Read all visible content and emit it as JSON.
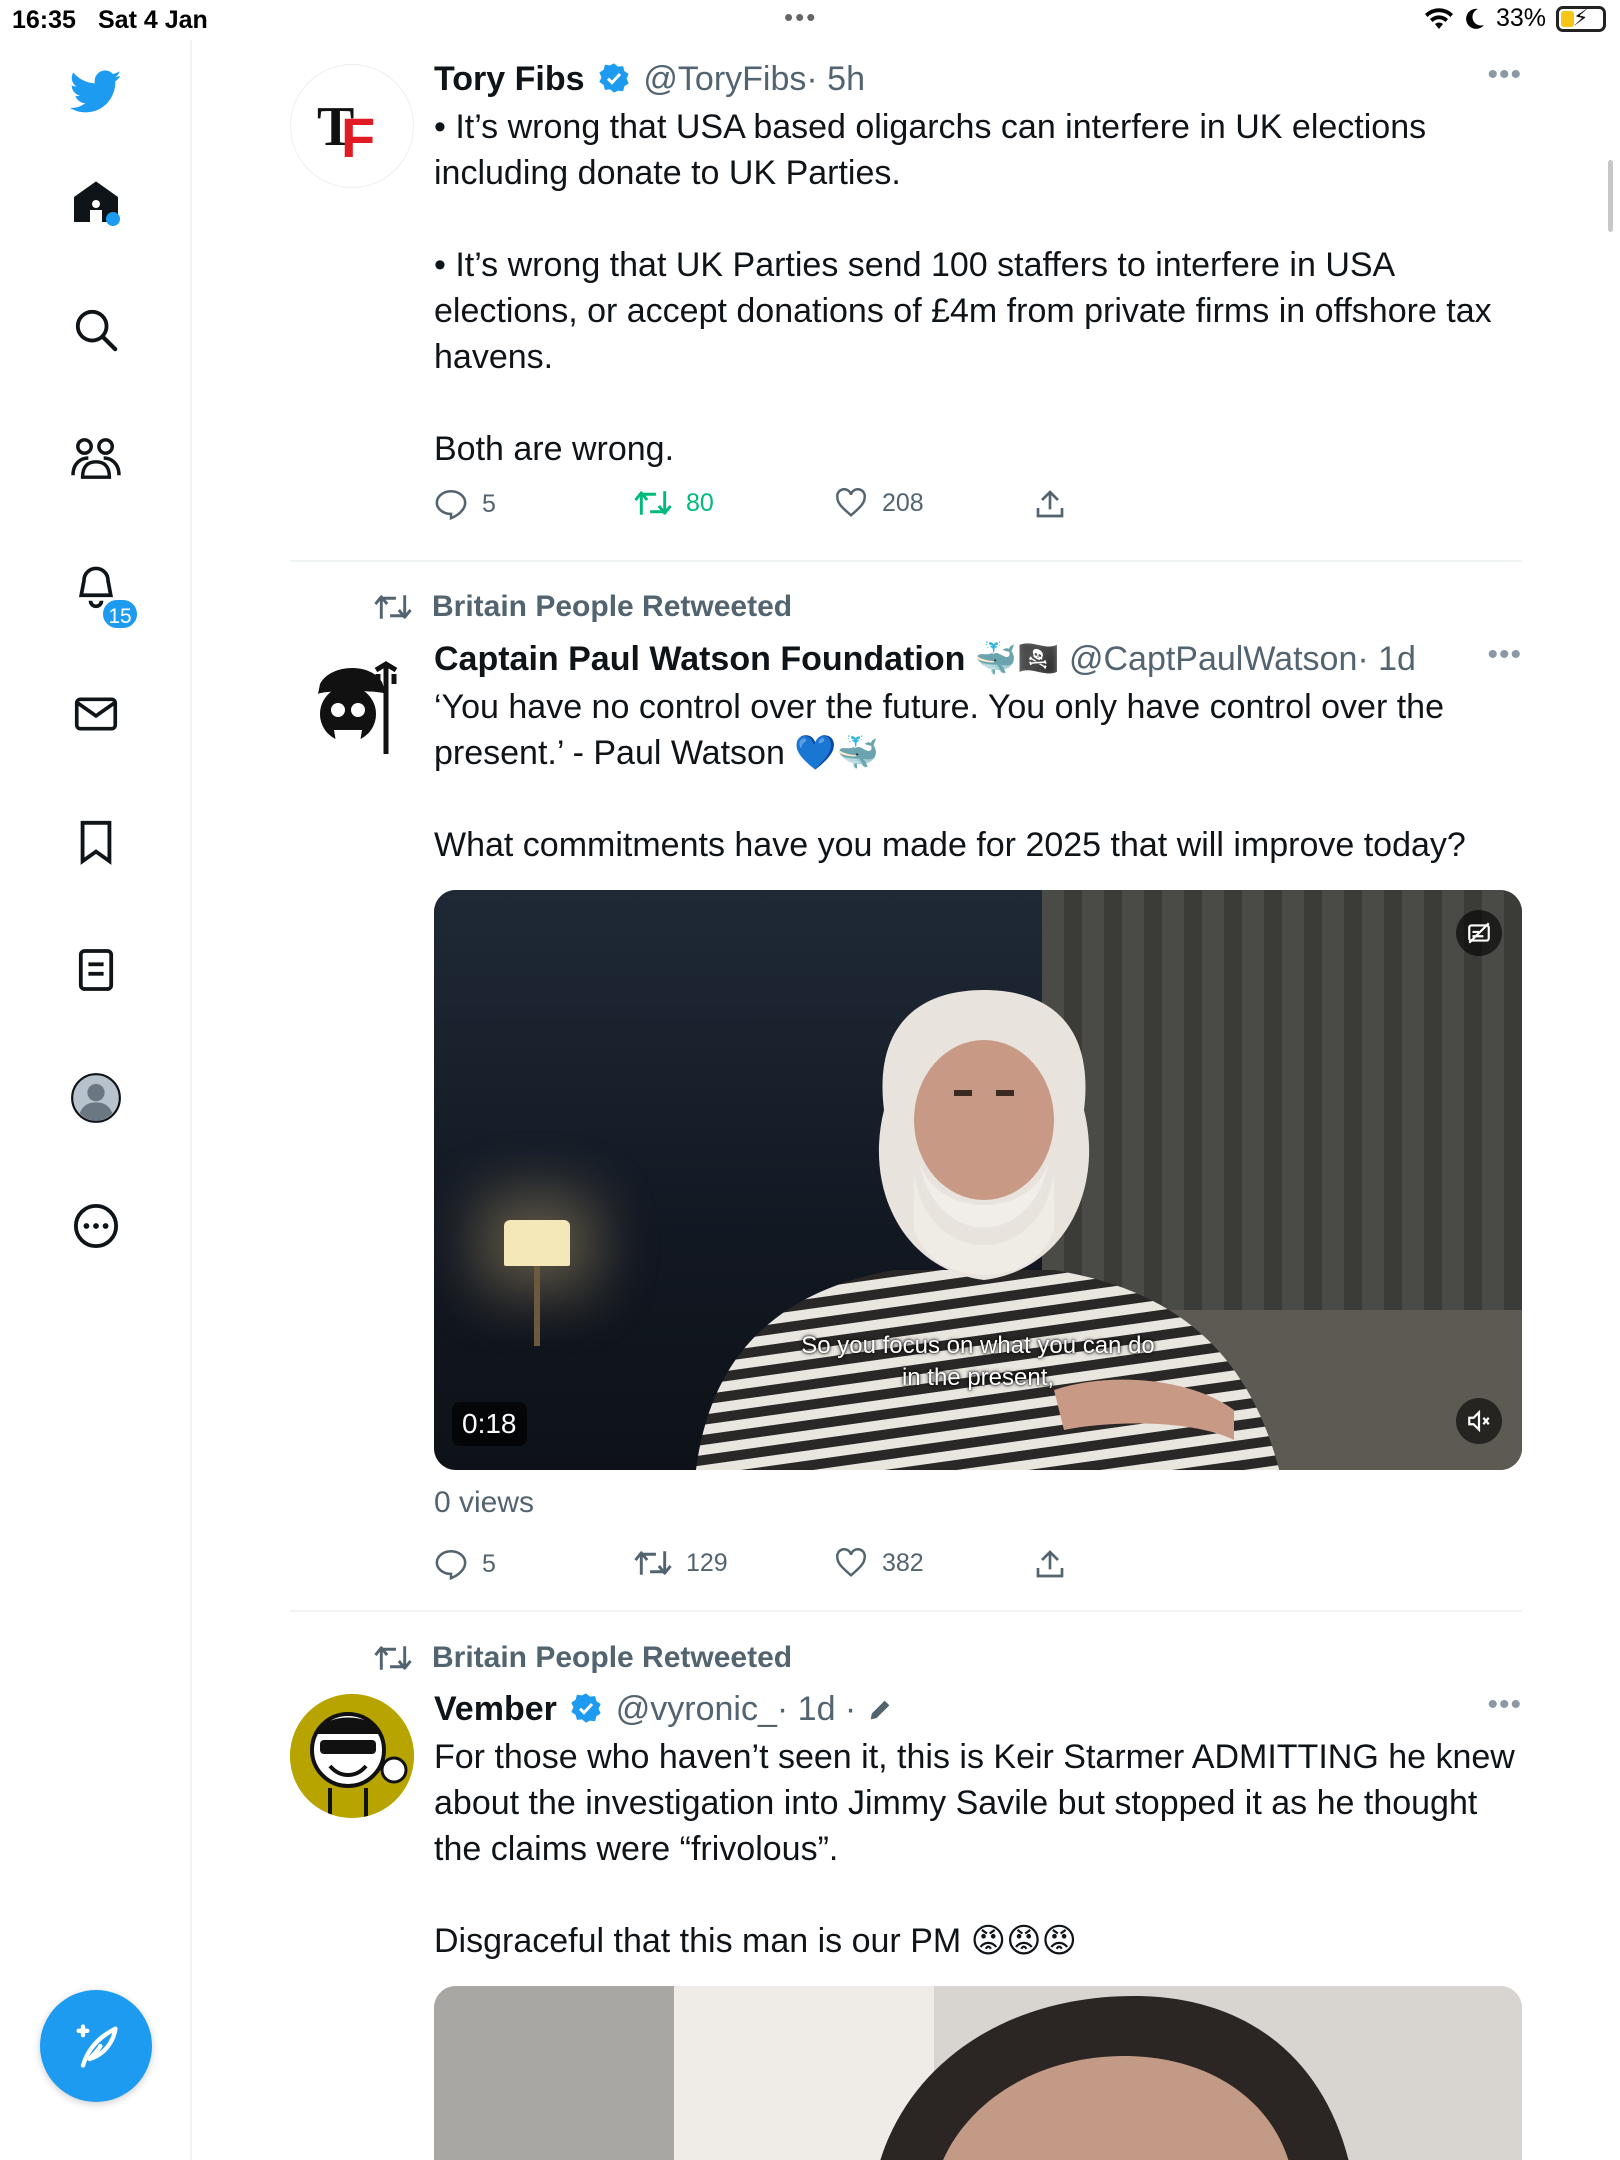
{
  "status_bar": {
    "time": "16:35",
    "date": "Sat 4 Jan",
    "battery": "33%",
    "battery_level": 0.33
  },
  "sidebar": {
    "notifications_badge": "15",
    "items": [
      "twitter-logo-icon",
      "home-icon",
      "search-icon",
      "communities-icon",
      "notifications-icon",
      "messages-icon",
      "bookmarks-icon",
      "lists-icon",
      "profile-icon",
      "more-icon"
    ]
  },
  "tweets": [
    {
      "name": "Tory Fibs",
      "handle": "@ToryFibs",
      "time": "· 5h",
      "avatar_text": "TF",
      "paragraphs": [
        "• It’s wrong that USA based oligarchs can interfere in UK elections including donate to UK Parties.",
        "• It’s wrong that UK Parties send 100 staffers to interfere in USA elections, or accept donations of £4m from private firms in offshore tax havens.",
        "Both are wrong."
      ],
      "replies": "5",
      "retweets": "80",
      "likes": "208"
    },
    {
      "retweeted_by": "Britain People Retweeted",
      "name": "Captain Paul Watson Foundation",
      "name_emoji": "🐳🏴‍☠️",
      "handle": "@CaptPaulWatson",
      "time": "· 1d",
      "paragraphs": [
        "‘You have no control over the future. You only have control over the present.’ - Paul Watson 💙🐳",
        "What commitments have you made for 2025 that will improve today?"
      ],
      "video": {
        "subtitle_line1": "So you focus on what you can do",
        "subtitle_line2": "in the present,",
        "duration": "0:18"
      },
      "views": "0 views",
      "replies": "5",
      "retweets": "129",
      "likes": "382"
    },
    {
      "retweeted_by": "Britain People Retweeted",
      "name": "Vember",
      "handle": "@vyronic_",
      "time": "· 1d ·",
      "paragraphs": [
        "For those who haven’t seen it, this is Keir Starmer ADMITTING he knew about the investigation into Jimmy Savile but stopped it as he thought the claims were “frivolous”.",
        "Disgraceful that this man is our PM 😡😡😡"
      ]
    }
  ],
  "colors": {
    "accent": "#1d9bf0",
    "retweet_green": "#00ba7c",
    "secondary_text": "#536471",
    "divider": "#eff3f4"
  }
}
